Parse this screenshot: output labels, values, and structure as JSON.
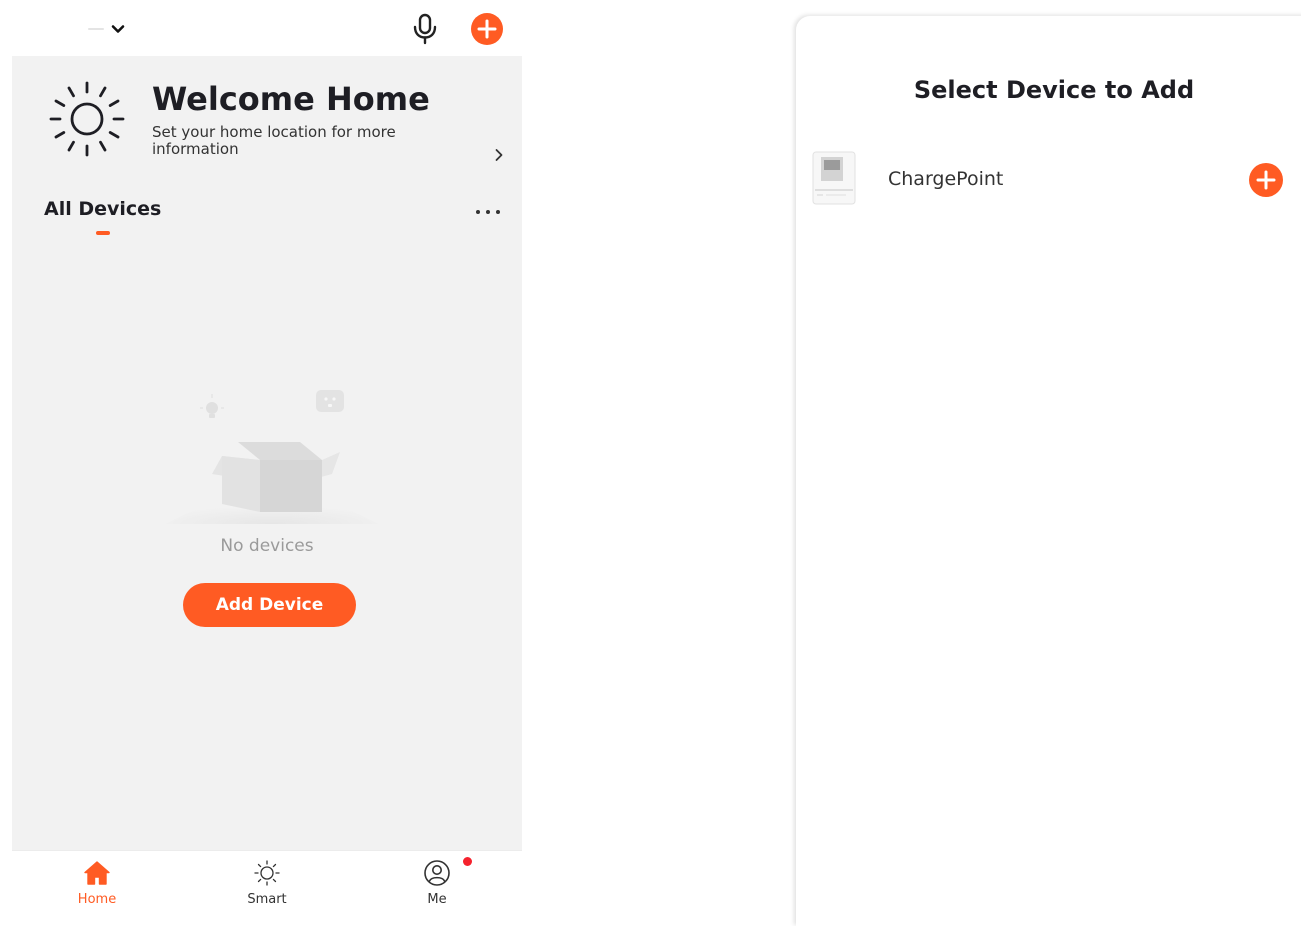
{
  "colors": {
    "accent": "#ff5b23",
    "badge": "#f5222d",
    "background": "#f2f2f2"
  },
  "topbar": {
    "home_selector_icon": "chevron-down-icon",
    "mic_icon": "microphone-icon",
    "add_icon": "plus-circle-icon"
  },
  "welcome": {
    "icon": "sun-icon",
    "title": "Welcome Home",
    "subtitle": "Set your home location for more information"
  },
  "devices": {
    "tab_label": "All Devices",
    "more_icon": "more-horizontal-icon",
    "empty_text": "No devices",
    "add_button_label": "Add Device"
  },
  "bottom_nav": {
    "items": [
      {
        "label": "Home",
        "icon": "home-icon",
        "active": true
      },
      {
        "label": "Smart",
        "icon": "smart-sun-icon",
        "active": false
      },
      {
        "label": "Me",
        "icon": "user-icon",
        "active": false,
        "badge": true
      }
    ]
  },
  "modal": {
    "title": "Select Device to Add",
    "devices": [
      {
        "name": "ChargePoint",
        "icon": "charger-device-icon",
        "action_icon": "plus-circle-icon"
      }
    ]
  }
}
